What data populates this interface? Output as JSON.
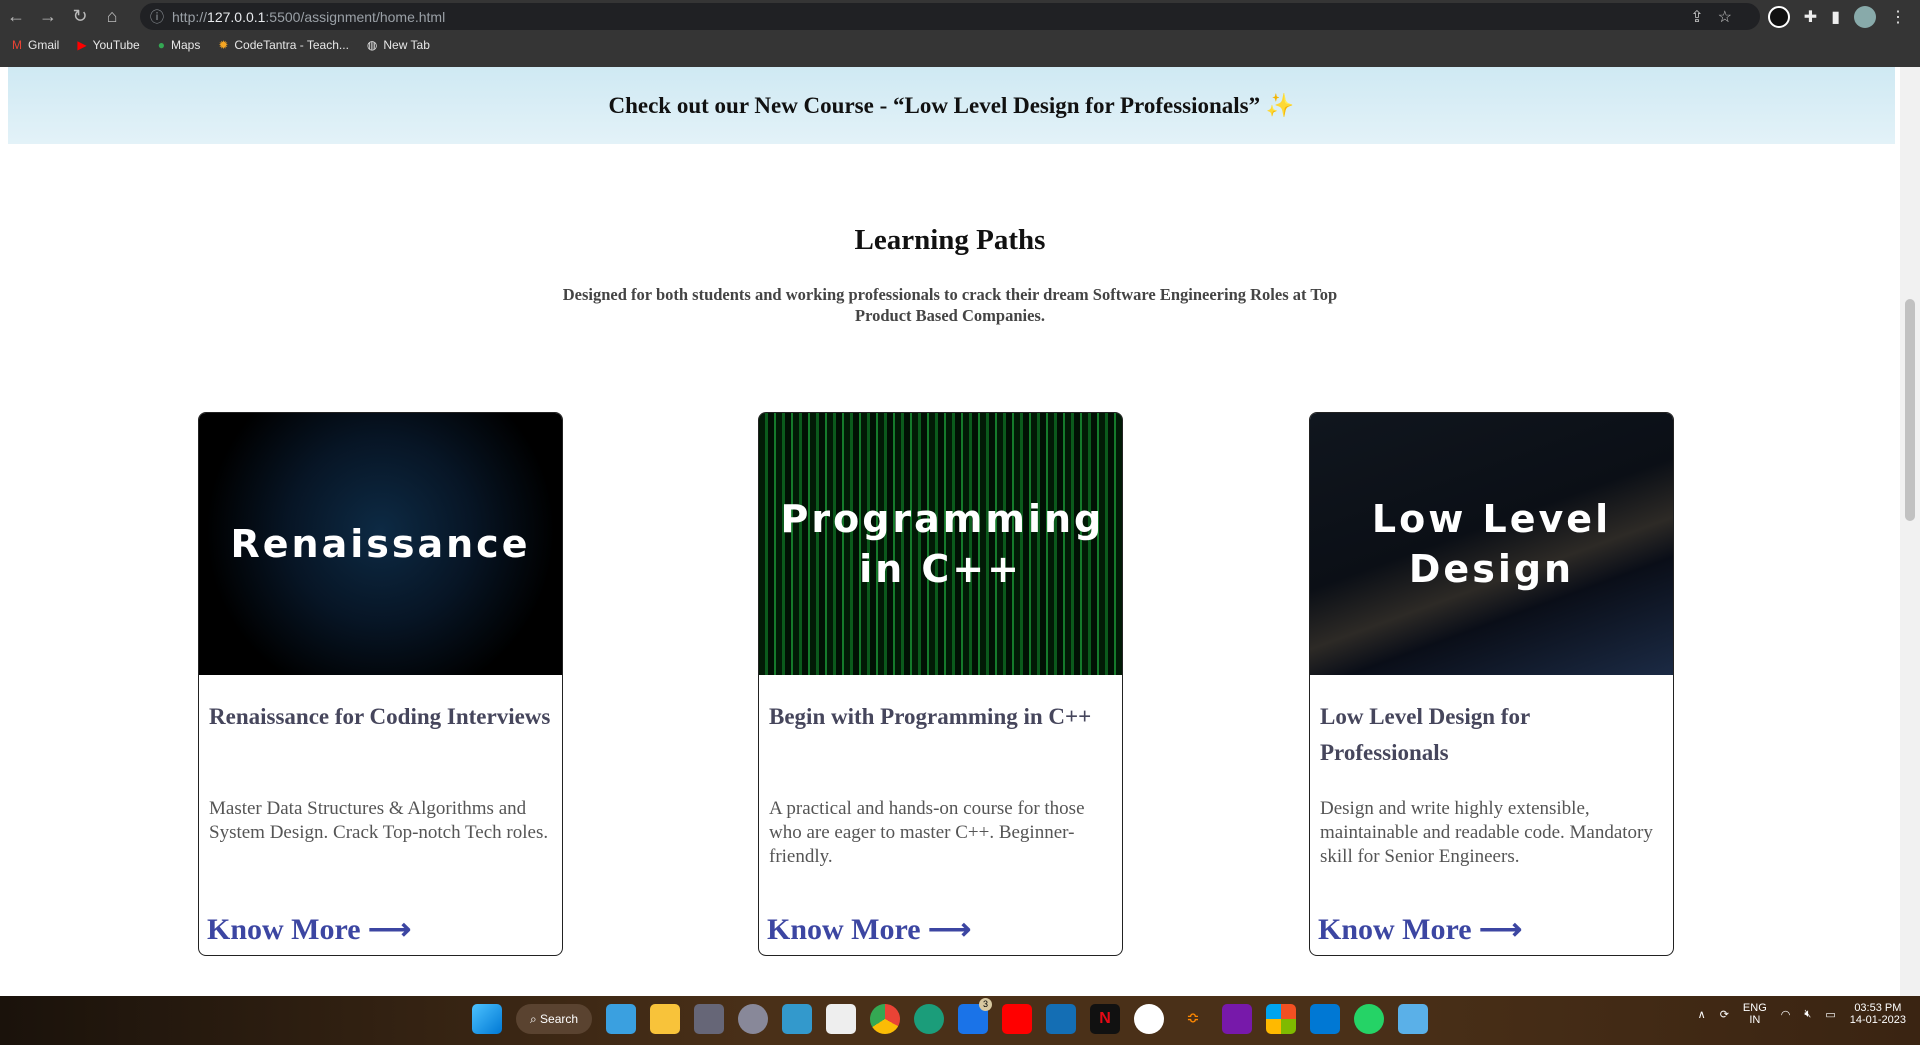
{
  "browser": {
    "url_host": "127.0.0.1",
    "url_prefix": "http://",
    "url_rest": ":5500/assignment/home.html",
    "bookmarks": [
      {
        "label": "Gmail",
        "icon": "gmail-icon"
      },
      {
        "label": "YouTube",
        "icon": "youtube-icon"
      },
      {
        "label": "Maps",
        "icon": "maps-icon"
      },
      {
        "label": "CodeTantra - Teach...",
        "icon": "codetantra-icon"
      },
      {
        "label": "New Tab",
        "icon": "globe-icon"
      }
    ]
  },
  "banner": {
    "text": "Check out our New Course - “Low Level Design for Professionals” ✨"
  },
  "section": {
    "title": "Learning Paths",
    "subtitle": "Designed for both students and working professionals to crack their dream Software Engineering Roles at Top Product Based Companies."
  },
  "cards": [
    {
      "image_text": "Renaissance",
      "title": "Renaissance for Coding Interviews",
      "description": "Master Data Structures & Algorithms and System Design. Crack Top-notch Tech roles.",
      "link": "Know More ⟶"
    },
    {
      "image_text": "Programming in C++",
      "title": "Begin with Programming in C++",
      "description": "A practical and hands-on course for those who are eager to master C++. Beginner-friendly.",
      "link": "Know More ⟶"
    },
    {
      "image_text": "Low Level Design",
      "title": "Low Level Design for Professionals",
      "description": "Design and write highly extensible, maintainable and readable code. Mandatory skill for Senior Engineers.",
      "link": "Know More ⟶"
    }
  ],
  "taskbar": {
    "search": "Search",
    "mail_badge": "3",
    "lang": "ENG",
    "region": "IN",
    "time": "03:53 PM",
    "date": "14-01-2023"
  },
  "colors": {
    "accent": "#3c46a2",
    "banner": "#d6ecf5"
  }
}
